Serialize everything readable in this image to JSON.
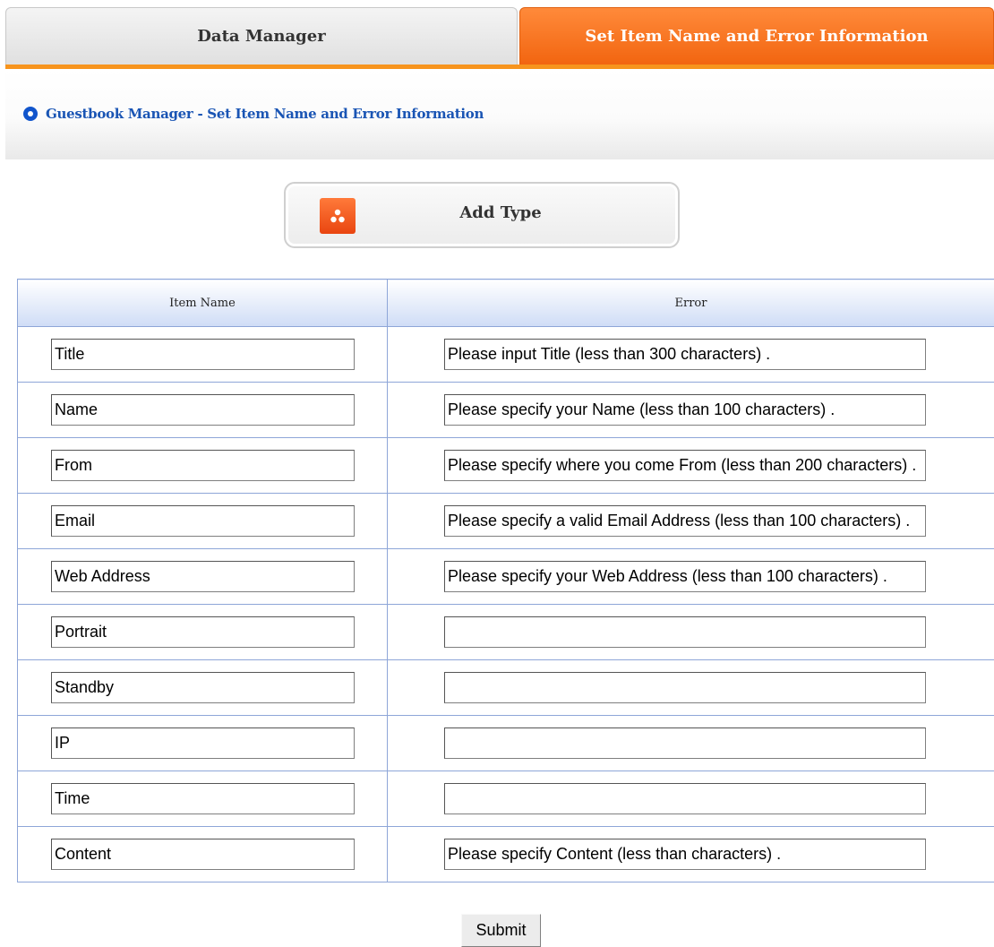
{
  "tabs": {
    "data_manager": "Data Manager",
    "set_item": "Set Item Name and Error Information"
  },
  "heading": "Guestbook Manager - Set Item Name and Error Information",
  "add_type_label": "Add Type",
  "table": {
    "headers": [
      "Item Name",
      "Error"
    ],
    "rows": [
      {
        "name": "Title",
        "error": "Please input Title (less than 300 characters) ."
      },
      {
        "name": "Name",
        "error": "Please specify your Name (less than 100 characters) ."
      },
      {
        "name": "From",
        "error": "Please specify where you come From (less than 200 characters) ."
      },
      {
        "name": "Email",
        "error": "Please specify a valid Email Address (less than 100 characters) ."
      },
      {
        "name": "Web Address",
        "error": "Please specify your Web Address (less than 100 characters) ."
      },
      {
        "name": "Portrait",
        "error": ""
      },
      {
        "name": "Standby",
        "error": ""
      },
      {
        "name": "IP",
        "error": ""
      },
      {
        "name": "Time",
        "error": ""
      },
      {
        "name": "Content",
        "error": "Please specify Content (less than characters) ."
      }
    ]
  },
  "submit_label": "Submit",
  "colors": {
    "active_tab": "#f26510",
    "tab_underline": "#f7941d",
    "heading_text": "#1a55b4",
    "table_border": "#8ea6d8"
  },
  "icons": {
    "heading": "radio-bullet-icon",
    "add_type": "add-type-icon"
  }
}
